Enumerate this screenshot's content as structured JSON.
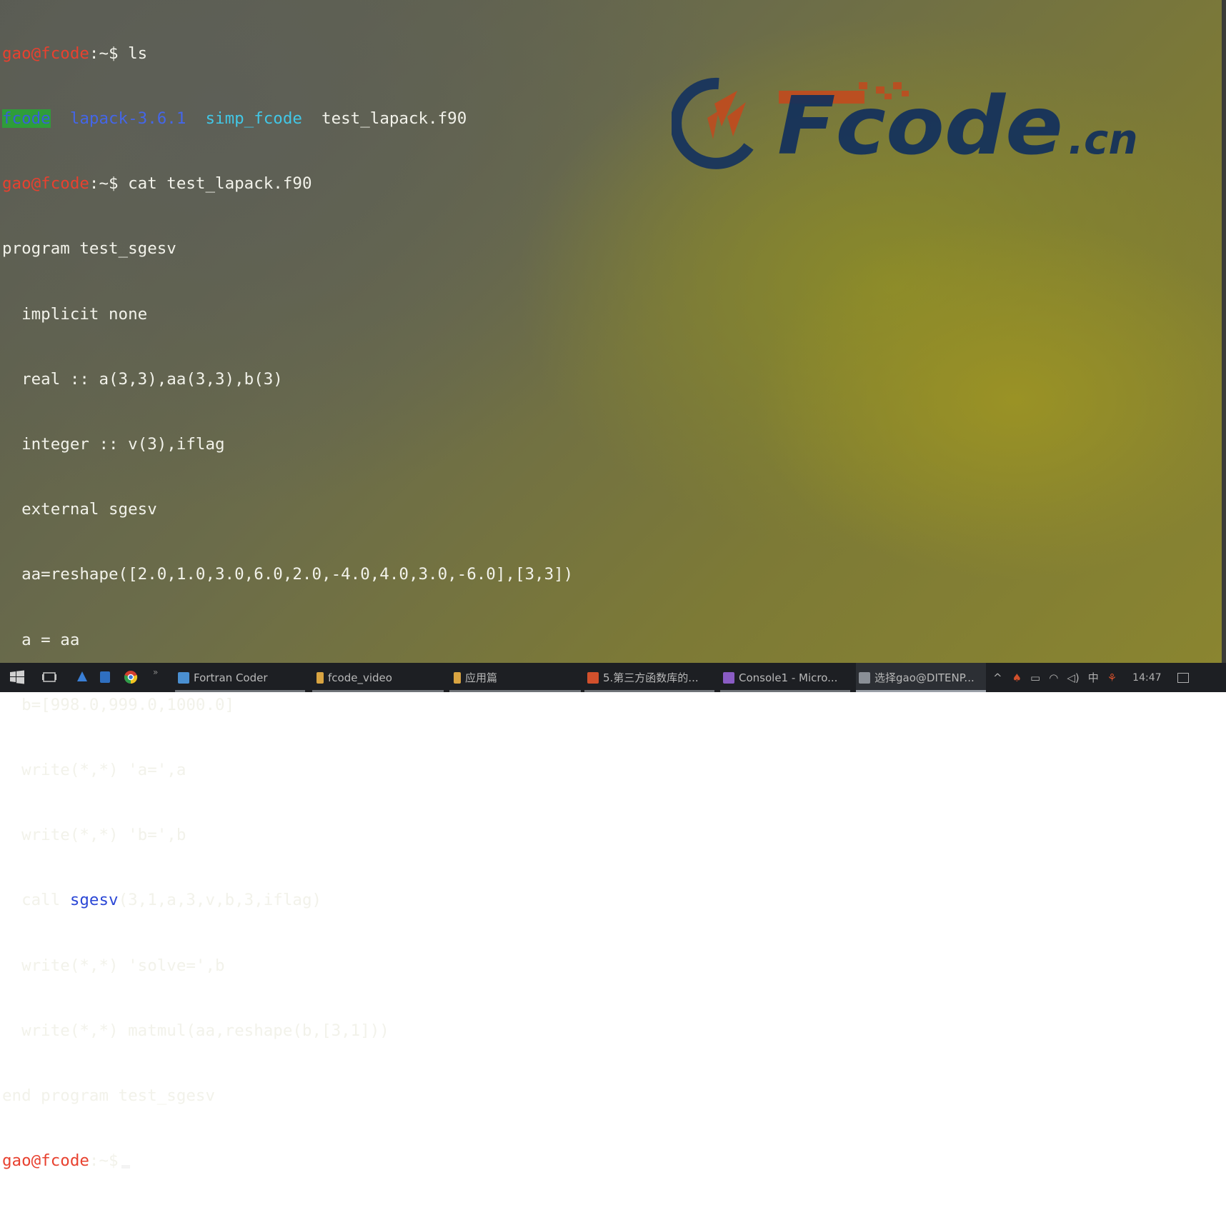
{
  "terminal": {
    "user_host": "gao@fcode",
    "prompt_tail": ":~$",
    "cmd1": " ls",
    "ls": [
      "fcode",
      "lapack-3.6.1",
      "simp_fcode",
      "test_lapack.f90"
    ],
    "cmd2": " cat test_lapack.f90",
    "code": [
      "program test_sgesv",
      "  implicit none",
      "  real :: a(3,3),aa(3,3),b(3)",
      "  integer :: v(3),iflag",
      "  external sgesv",
      "  aa=reshape([2.0,1.0,3.0,6.0,2.0,-4.0,4.0,3.0,-6.0],[3,3])",
      "  a = aa",
      "  b=[998.0,999.0,1000.0]",
      "  write(*,*) 'a=',a",
      "  write(*,*) 'b=',b"
    ],
    "call_prefix": "  call ",
    "call_highlight": "sgesv",
    "call_suffix": "(3,1,a,3,v,b,3,iflag)",
    "code_tail": [
      "  write(*,*) 'solve=',b",
      "  write(*,*) matmul(aa,reshape(b,[3,1]))",
      "end program test_sgesv"
    ]
  },
  "watermark": {
    "brand": "Fcode",
    "suffix": ".cn"
  },
  "taskbar": {
    "items": [
      {
        "label": "Fortran Coder",
        "color": "#4a8fd1"
      },
      {
        "label": "fcode_video",
        "color": "#d9a441"
      },
      {
        "label": "应用篇",
        "color": "#d9a441"
      },
      {
        "label": "5.第三方函数库的...",
        "color": "#d2502c"
      },
      {
        "label": "Console1 - Micro...",
        "color": "#8a5cc4"
      },
      {
        "label": "选择gao@DITENP...",
        "color": "#8a8f96"
      }
    ],
    "ime": "中",
    "clock": "14:47"
  },
  "colors": {
    "prompt": "#e8412f",
    "ls_dir_bg": "#2f9d3a",
    "ls_blue": "#4466e8",
    "ls_cyan": "#42c7e6",
    "highlight_bg": "#ffffff"
  }
}
